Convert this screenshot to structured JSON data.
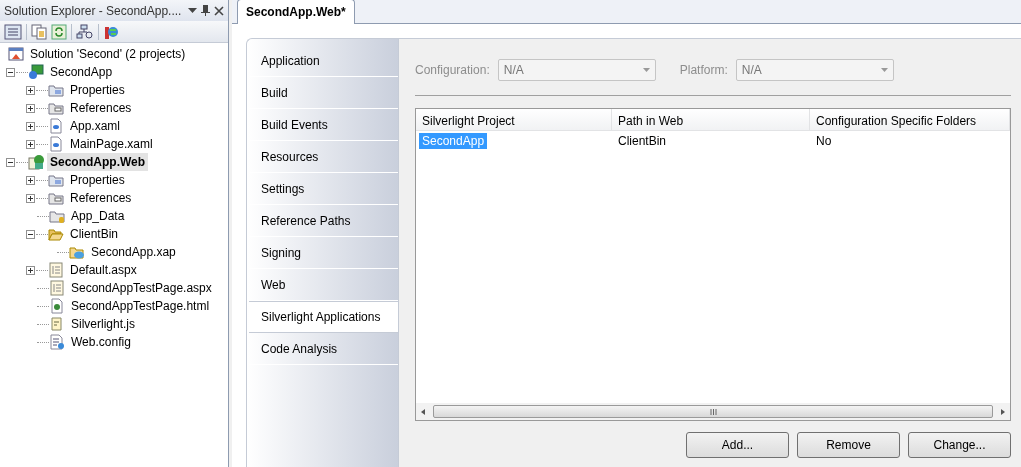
{
  "solution_explorer": {
    "title": "Solution Explorer - SecondApp....",
    "tree": [
      {
        "label": "Solution 'Second' (2 projects)",
        "kind": "solution",
        "selected": false,
        "children": [
          {
            "label": "SecondApp",
            "kind": "csproject",
            "expanded": true,
            "selected": false,
            "children": [
              {
                "label": "Properties",
                "kind": "properties",
                "expanded": false,
                "selected": false
              },
              {
                "label": "References",
                "kind": "references",
                "expanded": false,
                "selected": false
              },
              {
                "label": "App.xaml",
                "kind": "xaml",
                "expanded": false,
                "selected": false
              },
              {
                "label": "MainPage.xaml",
                "kind": "xaml",
                "expanded": false,
                "selected": false
              }
            ]
          },
          {
            "label": "SecondApp.Web",
            "kind": "webproject",
            "expanded": true,
            "selected": true,
            "children": [
              {
                "label": "Properties",
                "kind": "properties",
                "expanded": false,
                "selected": false
              },
              {
                "label": "References",
                "kind": "references",
                "expanded": false,
                "selected": false
              },
              {
                "label": "App_Data",
                "kind": "datafolder",
                "selected": false
              },
              {
                "label": "ClientBin",
                "kind": "openfolder",
                "expanded": true,
                "selected": false,
                "children": [
                  {
                    "label": "SecondApp.xap",
                    "kind": "xap",
                    "selected": false
                  }
                ]
              },
              {
                "label": "Default.aspx",
                "kind": "aspx",
                "expanded": false,
                "selected": false
              },
              {
                "label": "SecondAppTestPage.aspx",
                "kind": "aspx",
                "selected": false
              },
              {
                "label": "SecondAppTestPage.html",
                "kind": "html",
                "selected": false
              },
              {
                "label": "Silverlight.js",
                "kind": "script",
                "selected": false
              },
              {
                "label": "Web.config",
                "kind": "config",
                "selected": false
              }
            ]
          }
        ]
      }
    ]
  },
  "document_tabs": [
    {
      "label": "SecondApp.Web*",
      "selected": true
    }
  ],
  "pages": [
    {
      "label": "Application",
      "selected": false
    },
    {
      "label": "Build",
      "selected": false
    },
    {
      "label": "Build Events",
      "selected": false
    },
    {
      "label": "Resources",
      "selected": false
    },
    {
      "label": "Settings",
      "selected": false
    },
    {
      "label": "Reference Paths",
      "selected": false
    },
    {
      "label": "Signing",
      "selected": false
    },
    {
      "label": "Web",
      "selected": false
    },
    {
      "label": "Silverlight Applications",
      "selected": true
    },
    {
      "label": "Code Analysis",
      "selected": false
    }
  ],
  "configuration": {
    "label": "Configuration:",
    "value": "N/A",
    "disabled": true
  },
  "platform": {
    "label": "Platform:",
    "value": "N/A",
    "disabled": true
  },
  "grid": {
    "columns": [
      "Silverlight Project",
      "Path in Web",
      "Configuration Specific Folders"
    ],
    "rows": [
      {
        "cells": [
          "SecondApp",
          "ClientBin",
          "No"
        ],
        "selected": true
      }
    ]
  },
  "buttons": [
    "Add...",
    "Remove",
    "Change..."
  ]
}
